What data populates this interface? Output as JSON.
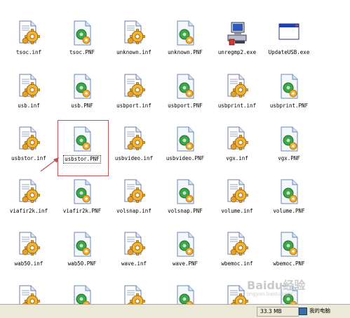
{
  "files": [
    {
      "name": "tsoc.inf",
      "kind": "inf"
    },
    {
      "name": "tsoc.PNF",
      "kind": "pnf"
    },
    {
      "name": "unknown.inf",
      "kind": "inf"
    },
    {
      "name": "unknown.PNF",
      "kind": "pnf"
    },
    {
      "name": "unregmp2.exe",
      "kind": "exe-computer"
    },
    {
      "name": "UpdateUSB.exe",
      "kind": "exe-window"
    },
    {
      "name": "usb.inf",
      "kind": "inf"
    },
    {
      "name": "usb.PNF",
      "kind": "pnf"
    },
    {
      "name": "usbport.inf",
      "kind": "inf"
    },
    {
      "name": "usbport.PNF",
      "kind": "pnf"
    },
    {
      "name": "usbprint.inf",
      "kind": "inf"
    },
    {
      "name": "usbprint.PNF",
      "kind": "pnf"
    },
    {
      "name": "usbstor.inf",
      "kind": "inf"
    },
    {
      "name": "usbstor.PNF",
      "kind": "pnf",
      "selected": true
    },
    {
      "name": "usbvideo.inf",
      "kind": "inf"
    },
    {
      "name": "usbvideo.PNF",
      "kind": "pnf"
    },
    {
      "name": "vgx.inf",
      "kind": "inf"
    },
    {
      "name": "vgx.PNF",
      "kind": "pnf"
    },
    {
      "name": "viafir2k.inf",
      "kind": "inf"
    },
    {
      "name": "viafir2k.PNF",
      "kind": "pnf"
    },
    {
      "name": "volsnap.inf",
      "kind": "inf"
    },
    {
      "name": "volsnap.PNF",
      "kind": "pnf"
    },
    {
      "name": "volume.inf",
      "kind": "inf"
    },
    {
      "name": "volume.PNF",
      "kind": "pnf"
    },
    {
      "name": "wab50.inf",
      "kind": "inf"
    },
    {
      "name": "wab50.PNF",
      "kind": "pnf"
    },
    {
      "name": "wave.inf",
      "kind": "inf"
    },
    {
      "name": "wave.PNF",
      "kind": "pnf"
    },
    {
      "name": "wbemoc.inf",
      "kind": "inf"
    },
    {
      "name": "wbemoc.PNF",
      "kind": "pnf"
    },
    {
      "name": "",
      "kind": "inf"
    },
    {
      "name": "",
      "kind": "pnf"
    },
    {
      "name": "",
      "kind": "inf"
    },
    {
      "name": "",
      "kind": "pnf"
    },
    {
      "name": "",
      "kind": "inf"
    },
    {
      "name": "",
      "kind": "pnf"
    }
  ],
  "statusbar": {
    "size": "33.3 MB",
    "location": "我的电脑"
  },
  "watermark": {
    "brand": "Baidu经验",
    "url": "jingyan.baidu.com"
  },
  "colors": {
    "selection_box": "#c0504d",
    "arrow": "#c0504d",
    "statusbar_bg": "#ece9d8"
  }
}
